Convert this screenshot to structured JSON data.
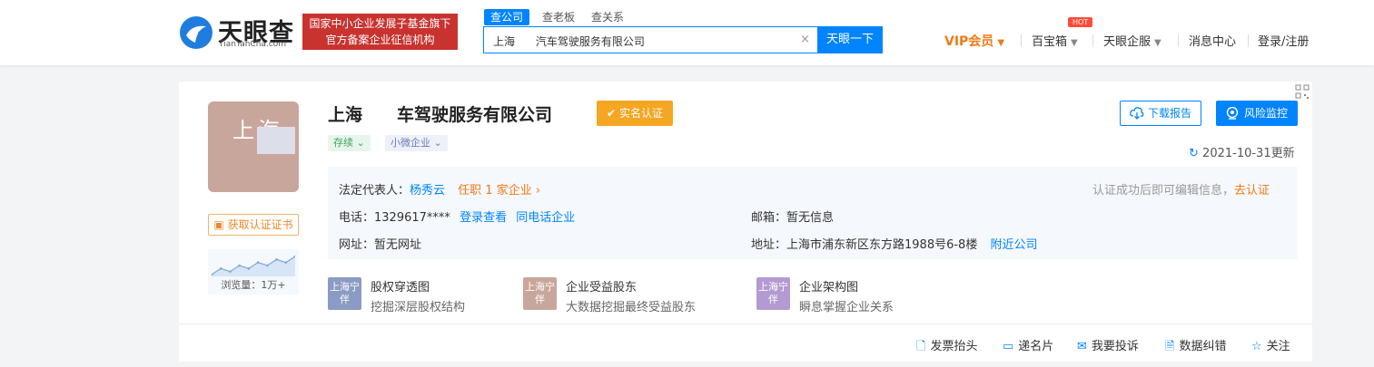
{
  "header": {
    "logo_text": "天眼查",
    "logo_sub": "TianYanCha.com",
    "gov_badge_line1": "国家中小企业发展子基金旗下",
    "gov_badge_line2": "官方备案企业征信机构",
    "search_tabs": [
      "查公司",
      "查老板",
      "查关系"
    ],
    "search_value": "上海      汽车驾驶服务有限公司",
    "search_clear": "×",
    "search_button": "天眼一下",
    "nav": {
      "vip": "VIP会员",
      "treasure": "百宝箱",
      "hot": "HOT",
      "enterprise": "天眼企服",
      "messages": "消息中心",
      "login": "登录/注册"
    },
    "colors": {
      "brand_blue": "#0084ff",
      "badge_red": "#c8332f",
      "vip_orange": "#f07a16"
    }
  },
  "company": {
    "avatar_text": "上海",
    "name_prefix": "上海",
    "name_suffix": "车驾驶服务有限公司",
    "verified_badge": "实名认证",
    "status_tag": "存续",
    "scale_tag": "小微企业",
    "download_button": "下载报告",
    "risk_button": "风险监控",
    "update_text": "2021-10-31更新",
    "cert_link": "获取认证证书",
    "views_label": "浏览量：1万+",
    "views_trend": [
      3,
      5,
      4,
      6,
      5,
      7,
      6,
      8,
      7,
      9
    ]
  },
  "info": {
    "legal_rep_label": "法定代表人：",
    "legal_rep_name": "杨秀云",
    "legal_rep_positions": "任职 1 家企业",
    "edit_hint": "认证成功后即可编辑信息，",
    "edit_link": "去认证",
    "phone_label": "电话：",
    "phone_value": "1329617****",
    "phone_login": "登录查看",
    "phone_same": "同电话企业",
    "email_label": "邮箱：",
    "email_value": "暂无信息",
    "website_label": "网址：",
    "website_value": "暂无网址",
    "address_label": "地址：",
    "address_value": "上海市浦东新区东方路1988号6-8楼",
    "address_nearby": "附近公司"
  },
  "features": [
    {
      "icon_text": "上海宁伴",
      "title": "股权穿透图",
      "subtitle": "挖掘深层股权结构",
      "color": "#8a9bc4"
    },
    {
      "icon_text": "上海宁伴",
      "title": "企业受益股东",
      "subtitle": "大数据挖掘最终受益股东",
      "color": "#c9a69b"
    },
    {
      "icon_text": "上海宁伴",
      "title": "企业架构图",
      "subtitle": "瞬息掌握企业关系",
      "color": "#b39ad0"
    }
  ],
  "actions": {
    "invoice": "发票抬头",
    "card": "递名片",
    "complain": "我要投诉",
    "correct": "数据纠错",
    "follow": "关注"
  }
}
